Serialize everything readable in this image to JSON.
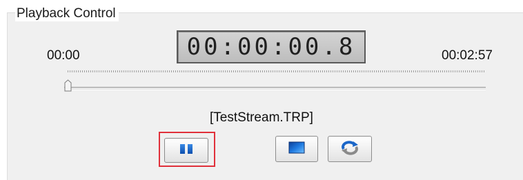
{
  "group": {
    "title": "Playback Control"
  },
  "timer": {
    "display": "00:00:00.8",
    "start": "00:00",
    "end": "00:02:57"
  },
  "seek": {
    "position_fraction": 0.0
  },
  "file": {
    "name": "[TestStream.TRP]"
  },
  "buttons": {
    "pause": {
      "icon": "pause-icon"
    },
    "stop": {
      "icon": "stop-icon"
    },
    "loop": {
      "icon": "repeat-icon"
    }
  },
  "colors": {
    "highlight": "#e0303a",
    "icon_blue": "#1a66c8"
  }
}
